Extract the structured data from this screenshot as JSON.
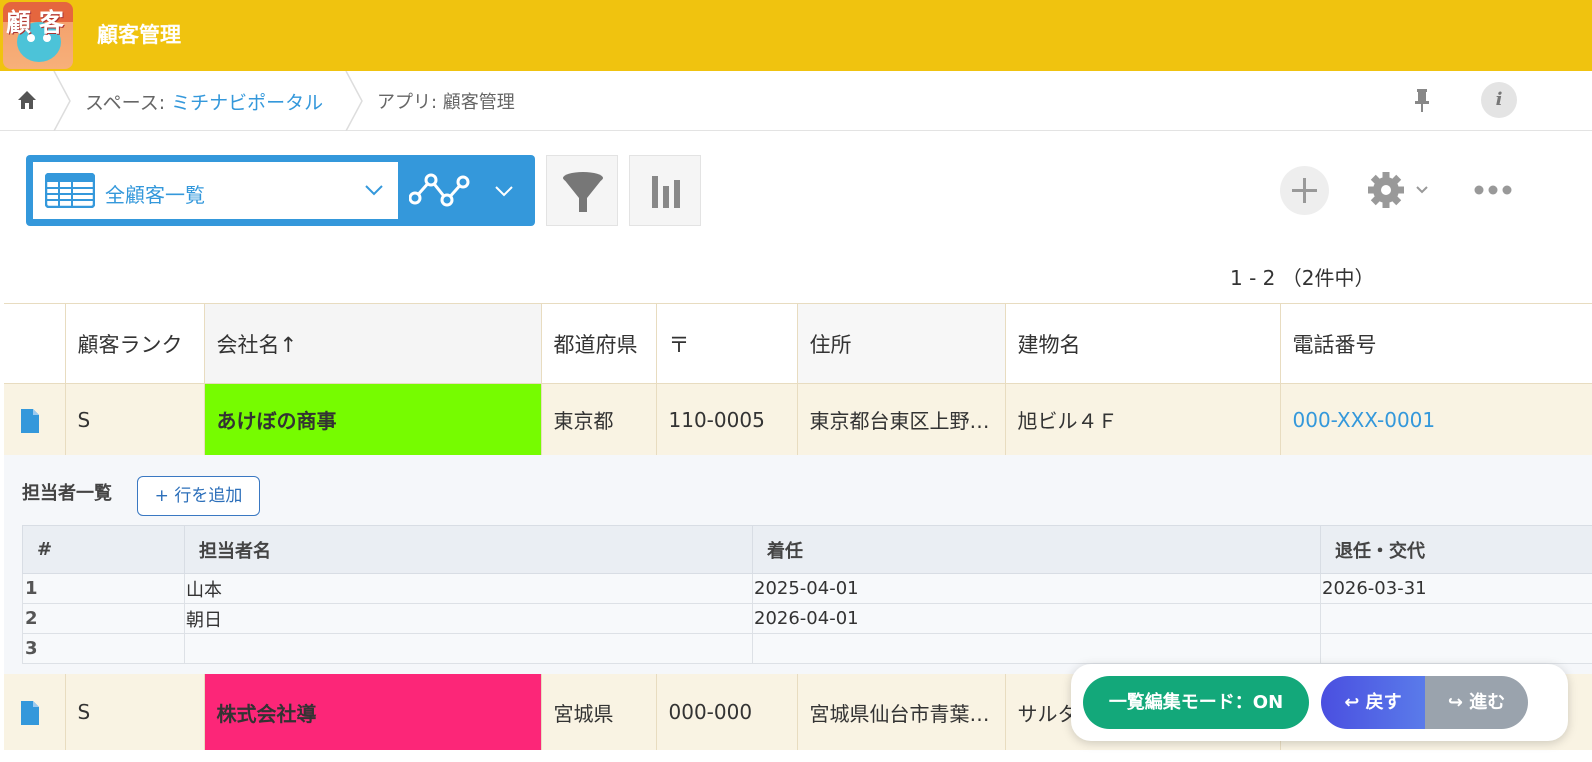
{
  "header": {
    "logo_text": "顧客",
    "app_title": "顧客管理",
    "background_color": "#f0c30f"
  },
  "breadcrumb": {
    "home_icon": "home-icon",
    "space_prefix": "スペース:",
    "space_name": "ミチナビポータル",
    "app_label": "アプリ: 顧客管理",
    "pin_icon": "pin-icon",
    "info_icon_text": "i"
  },
  "toolbar": {
    "view_name": "全顧客一覧",
    "accent_color": "#3498db",
    "pagination": "1 - 2 （2件中）"
  },
  "table": {
    "columns": [
      "",
      "顧客ランク",
      "会社名↑",
      "都道府県",
      "〒",
      "住所",
      "建物名",
      "電話番号"
    ],
    "records": [
      {
        "rank": "S",
        "company": "あけぼの商事",
        "company_color": "#76fc00",
        "prefecture": "東京都",
        "zip": "110-0005",
        "address": "東京都台東区上野…",
        "building": "旭ビル４Ｆ",
        "tel": "000-XXX-0001"
      },
      {
        "rank": "S",
        "company": "株式会社導",
        "company_color": "#fc2678",
        "prefecture": "宮城県",
        "zip": "000-000",
        "address": "宮城県仙台市青葉…",
        "building": "サルタ",
        "tel": ""
      }
    ]
  },
  "subtable": {
    "title": "担当者一覧",
    "add_row_label": "+ 行を追加",
    "columns": [
      "#",
      "担当者名",
      "着任",
      "退任・交代"
    ],
    "rows": [
      {
        "num": "1",
        "name": "山本",
        "start": "2025-04-01",
        "end": "2026-03-31"
      },
      {
        "num": "2",
        "name": "朝日",
        "start": "2026-04-01",
        "end": ""
      },
      {
        "num": "3",
        "name": "",
        "start": "",
        "end": ""
      }
    ]
  },
  "mode_panel": {
    "edit_mode_label": "一覧編集モード：ON",
    "back_label": "↩ 戻す",
    "forward_label": "↪ 進む"
  }
}
